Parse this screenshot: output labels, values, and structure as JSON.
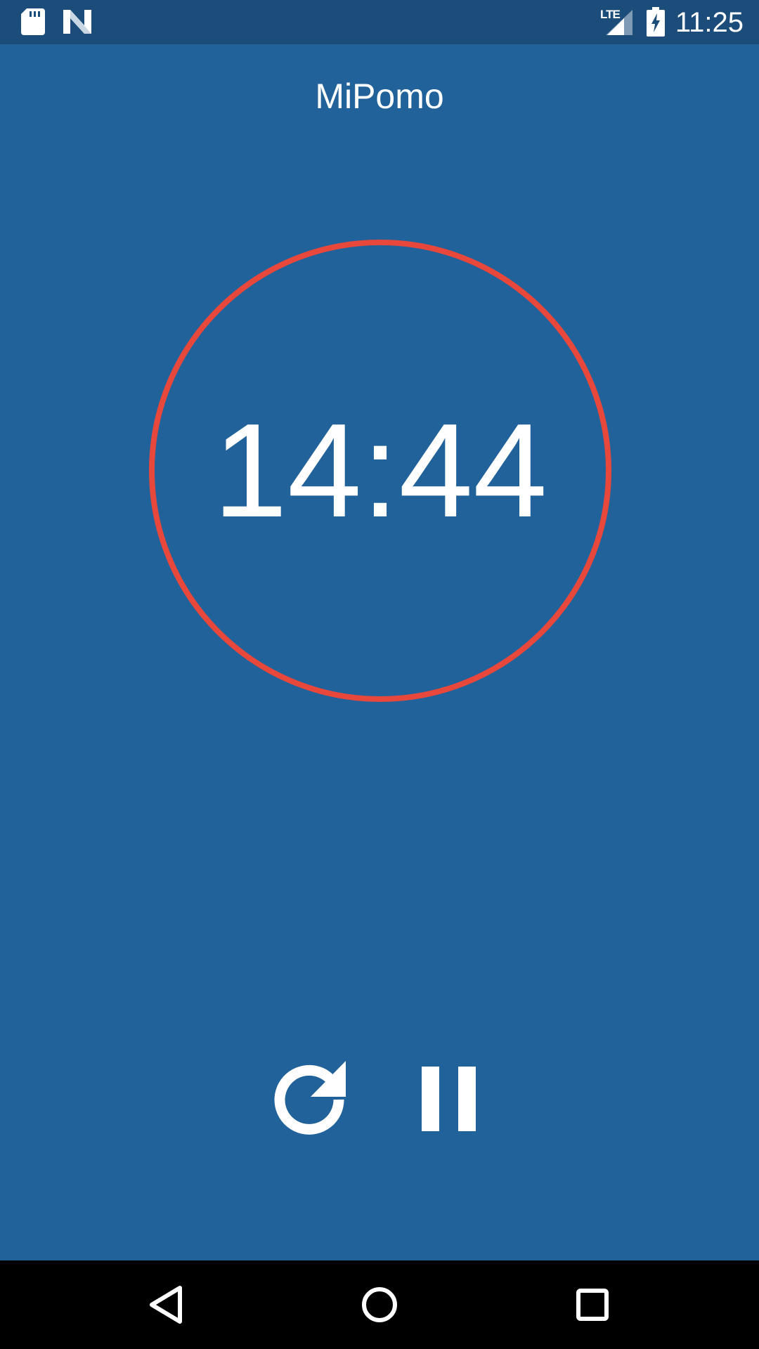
{
  "status_bar": {
    "time": "11:25",
    "network_label": "LTE",
    "icons": [
      "sd-card-icon",
      "n-logo-icon",
      "signal-icon",
      "battery-charging-icon"
    ]
  },
  "app": {
    "title": "MiPomo"
  },
  "timer": {
    "remaining": "14:44",
    "ring_color": "#e8473b"
  },
  "controls": {
    "icons": [
      "reset-icon",
      "pause-icon"
    ]
  },
  "nav_bar": {
    "icons": [
      "back-icon",
      "home-icon",
      "recents-icon"
    ]
  },
  "colors": {
    "background": "#22629a",
    "status_bar": "#1c4d7a",
    "accent": "#e8473b",
    "nav_bar": "#000000"
  }
}
